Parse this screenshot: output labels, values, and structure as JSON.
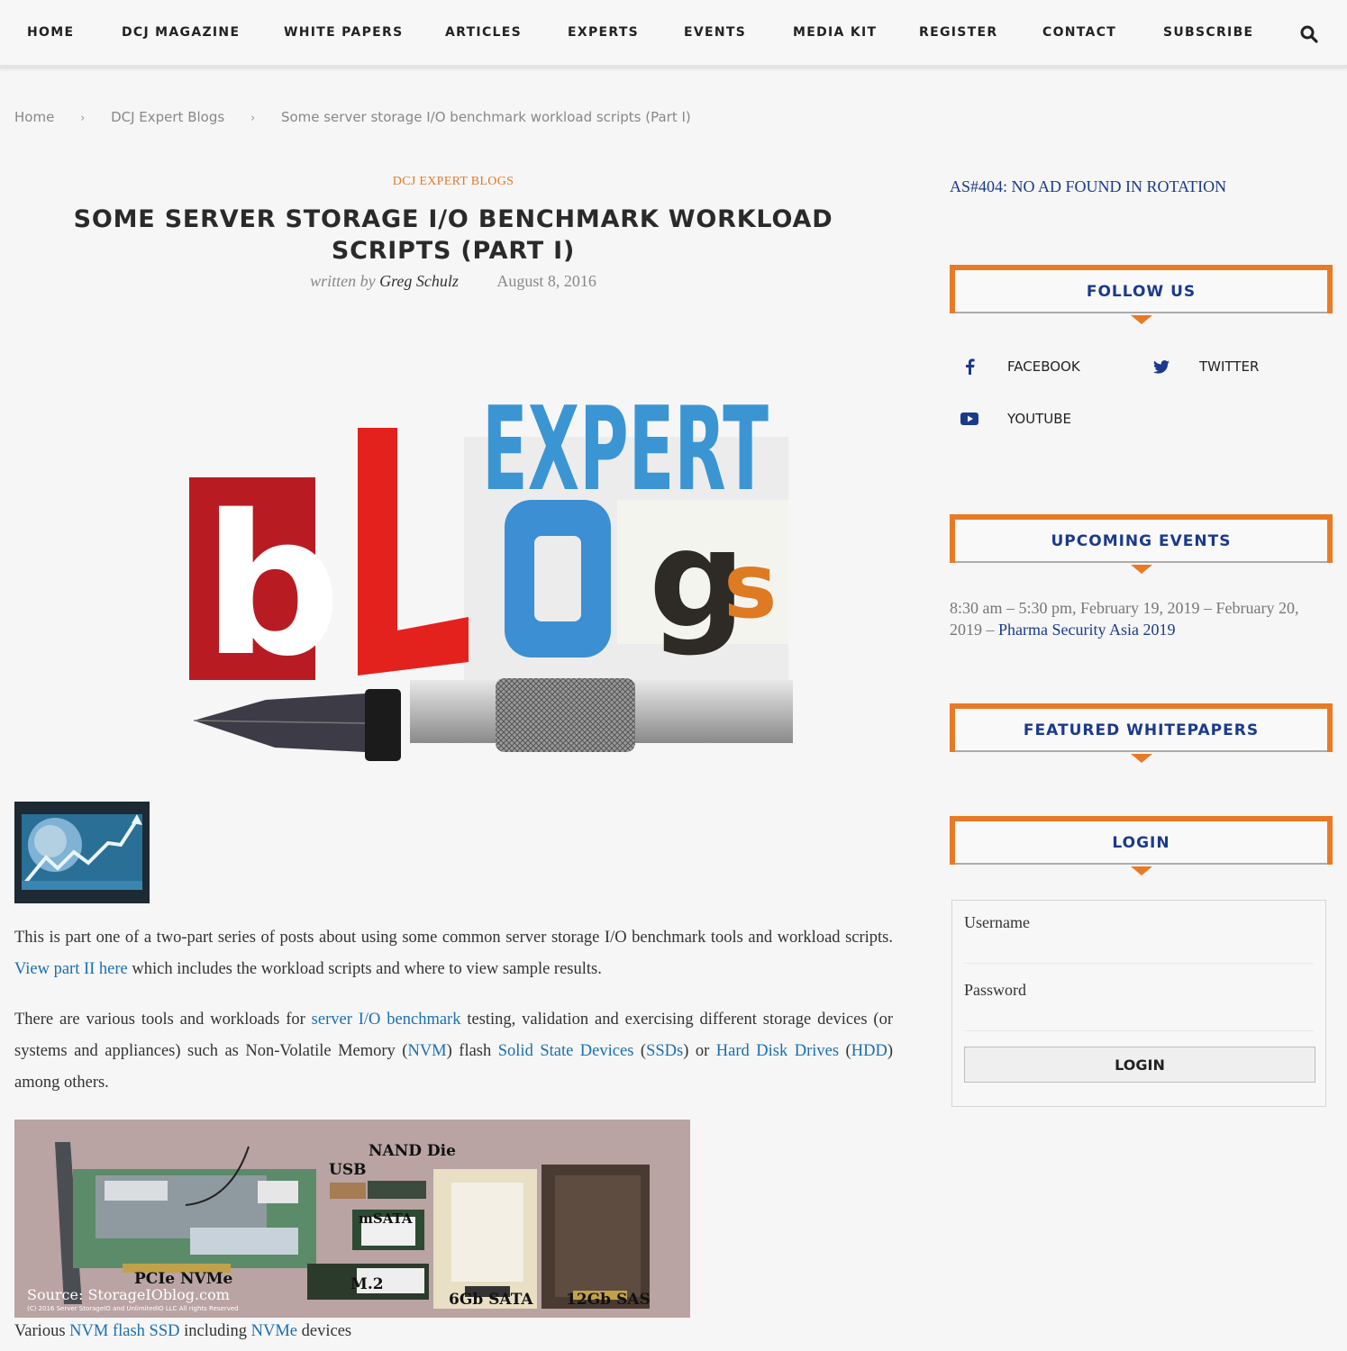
{
  "nav": {
    "items": [
      {
        "label": "HOME"
      },
      {
        "label": "DCJ MAGAZINE"
      },
      {
        "label": "WHITE PAPERS"
      },
      {
        "label": "ARTICLES"
      },
      {
        "label": "EXPERTS"
      },
      {
        "label": "EVENTS"
      },
      {
        "label": "MEDIA KIT"
      },
      {
        "label": "REGISTER"
      },
      {
        "label": "CONTACT"
      },
      {
        "label": "SUBSCRIBE"
      }
    ],
    "search_icon": "search-icon"
  },
  "breadcrumb": {
    "items": [
      "Home",
      "DCJ Expert Blogs",
      "Some server storage I/O benchmark workload scripts (Part I)"
    ],
    "separator": "›"
  },
  "article": {
    "category": "DCJ EXPERT BLOGS",
    "title": "SOME SERVER STORAGE I/O BENCHMARK WORKLOAD SCRIPTS (PART I)",
    "written_by": "written by",
    "author": "Greg Schulz",
    "date": "August 8, 2016",
    "hero_image": {
      "letters": [
        "EXPERT",
        "b",
        "L",
        "O",
        "g",
        "s"
      ]
    },
    "thumbnail": "globe-chart-thumbnail",
    "paragraph1": {
      "t1": "This is part one of a two-part series of posts about using some common server storage I/O benchmark tools and workload scripts. ",
      "link1": "View part II here",
      "t2": " which includes the workload scripts and where to view sample results."
    },
    "paragraph2": {
      "t1": "There are various tools and workloads for ",
      "link1": "server I/O benchmark",
      "t2": " testing, validation and exercising different storage devices (or systems and appliances) such as Non-Volatile Memory (",
      "link2": "NVM",
      "t3": ") flash ",
      "link3": "Solid State Devices",
      "t4": " (",
      "link4": "SSDs",
      "t5": ") or ",
      "link5": "Hard Disk Drives",
      "t6": " (",
      "link6": "HDD",
      "t7": ") among others."
    },
    "ssd_image": {
      "labels": [
        "NAND Die",
        "USB",
        "mSATA",
        "PCIe NVMe",
        "M.2",
        "6Gb SATA",
        "12Gb SAS"
      ],
      "source": "Source: StorageIOblog.com",
      "copyright": "(C) 2016 Server StorageIO and UnlimitedIO LLC All rights Reserved"
    },
    "caption": {
      "t1": "Various ",
      "link1": "NVM flash SSD",
      "t2": " including ",
      "link2": "NVMe",
      "t3": " devices"
    }
  },
  "sidebar": {
    "ad_text": "AS#404: NO AD FOUND IN ROTATION",
    "follow_us": {
      "title": "FOLLOW US",
      "links": [
        {
          "label": "FACEBOOK",
          "icon": "facebook-icon"
        },
        {
          "label": "TWITTER",
          "icon": "twitter-icon"
        },
        {
          "label": "YOUTUBE",
          "icon": "youtube-icon"
        }
      ]
    },
    "upcoming_events": {
      "title": "UPCOMING EVENTS",
      "event_time": "8:30 am – 5:30 pm, February 19, 2019 – February 20, 2019 – ",
      "event_link": "Pharma Security Asia 2019"
    },
    "featured_whitepapers": {
      "title": "FEATURED WHITEPAPERS"
    },
    "login": {
      "title": "LOGIN",
      "username_label": "Username",
      "username_value": "",
      "password_label": "Password",
      "password_value": "",
      "button": "LOGIN"
    }
  },
  "colors": {
    "accent_orange": "#e87a26",
    "heading_blue": "#1c3a8c",
    "link_blue": "#1a6fb0"
  }
}
